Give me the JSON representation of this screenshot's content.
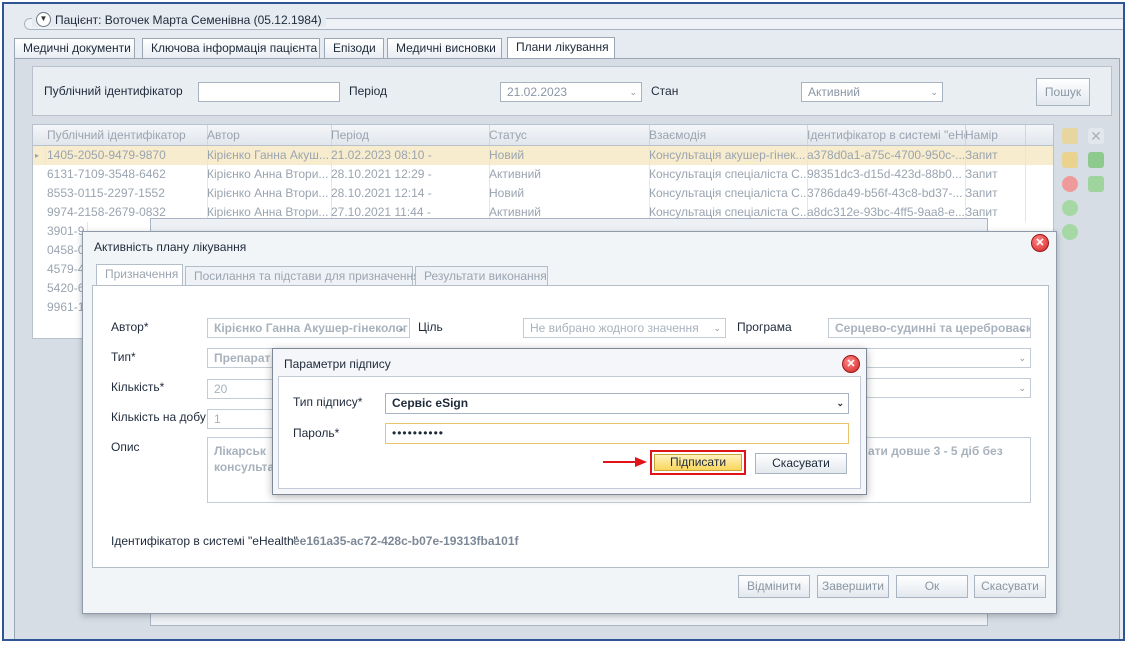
{
  "patient_group": {
    "expand_icon": "chevron-down-icon",
    "title": "Пацієнт: Воточек Марта Семенівна (05.12.1984)"
  },
  "tabs": [
    {
      "label": "Медичні документи"
    },
    {
      "label": "Ключова інформація пацієнта"
    },
    {
      "label": "Епізоди"
    },
    {
      "label": "Медичні висновки"
    },
    {
      "label": "Плани лікування",
      "active": true
    }
  ],
  "filter": {
    "public_id_label": "Публічний ідентифікатор",
    "public_id_value": "",
    "period_label": "Період",
    "period_value": "21.02.2023",
    "state_label": "Стан",
    "state_value": "Активний",
    "search_button": "Пошук"
  },
  "grid": {
    "columns": [
      "Публічний ідентифікатор",
      "Автор",
      "Період",
      "Статус",
      "Взаємодія",
      "Ідентифікатор в системі \"eHe",
      "Намір"
    ],
    "rows": [
      [
        "1405-2050-9479-9870",
        "Кірієнко Ганна Акуш...",
        "21.02.2023 08:10 -",
        "Новий",
        "Консультація акушер-гінек...",
        "a378d0a1-a75c-4700-950c-...",
        "Запит"
      ],
      [
        "6131-7109-3548-6462",
        "Кірієнко Анна Втори...",
        "28.10.2021 12:29 -",
        "Активний",
        "Консультація спеціаліста С...",
        "98351dc3-d15d-423d-88b0...",
        "Запит"
      ],
      [
        "8553-0115-2297-1552",
        "Кірієнко Анна Втори...",
        "28.10.2021 12:14 -",
        "Новий",
        "Консультація спеціаліста С...",
        "3786da49-b56f-43c8-bd37-...",
        "Запит"
      ],
      [
        "9974-2158-2679-0832",
        "Кірієнко Анна Втори...",
        "27.10.2021 11:44 -",
        "Активний",
        "Консультація спеціаліста С...",
        "a8dc312e-93bc-4ff5-9aa8-e...",
        "Запит"
      ],
      [
        "3901-9",
        "",
        "",
        "",
        "",
        "",
        ""
      ],
      [
        "0458-0",
        "",
        "",
        "",
        "",
        "",
        ""
      ],
      [
        "4579-4",
        "",
        "",
        "",
        "",
        "",
        ""
      ],
      [
        "5420-6",
        "",
        "",
        "",
        "",
        "",
        ""
      ],
      [
        "9961-1",
        "",
        "",
        "",
        "",
        "",
        ""
      ]
    ]
  },
  "activity_dialog": {
    "title": "Активність плану лікування",
    "tabs": [
      "Призначення",
      "Посилання та підстави для призначення",
      "Результати виконання"
    ],
    "author_label": "Автор*",
    "author_value": "Кірієнко Ганна Акушер-гінеколог",
    "goal_label": "Ціль",
    "goal_value": "Не вибрано жодного значення",
    "program_label": "Програма",
    "program_value": "Серцево-судинні та цереброваск",
    "type_label": "Тип*",
    "type_value": "Препарат",
    "qty_label": "Кількість*",
    "qty_value": "20",
    "qty_day_label": "Кількість на добу",
    "qty_day_value": "1",
    "desc_label": "Опис",
    "desc_line1_left": "Лікарськ",
    "desc_line2_left": "консульта",
    "desc_line1_right": "ати довше 3 - 5 діб без",
    "ehealth_label": "Ідентифікатор в системі \"eHealth\"",
    "ehealth_value": "ee161a35-ac72-428c-b07e-19313fba101f",
    "btn_cancel_action": "Відмінити",
    "btn_finish": "Завершити",
    "btn_ok": "Ок",
    "btn_cancel": "Скасувати"
  },
  "sign_dialog": {
    "title": "Параметри підпису",
    "sign_type_label": "Тип підпису*",
    "sign_type_value": "Сервіс eSign",
    "password_label": "Пароль*",
    "password_value": "••••••••••",
    "sign_button": "Підписати",
    "cancel_button": "Скасувати"
  },
  "colors": {
    "frame": "#2f5597",
    "selected_row": "#f7eccd",
    "highlight": "#e0131a",
    "sign_button": "#fde48a"
  }
}
